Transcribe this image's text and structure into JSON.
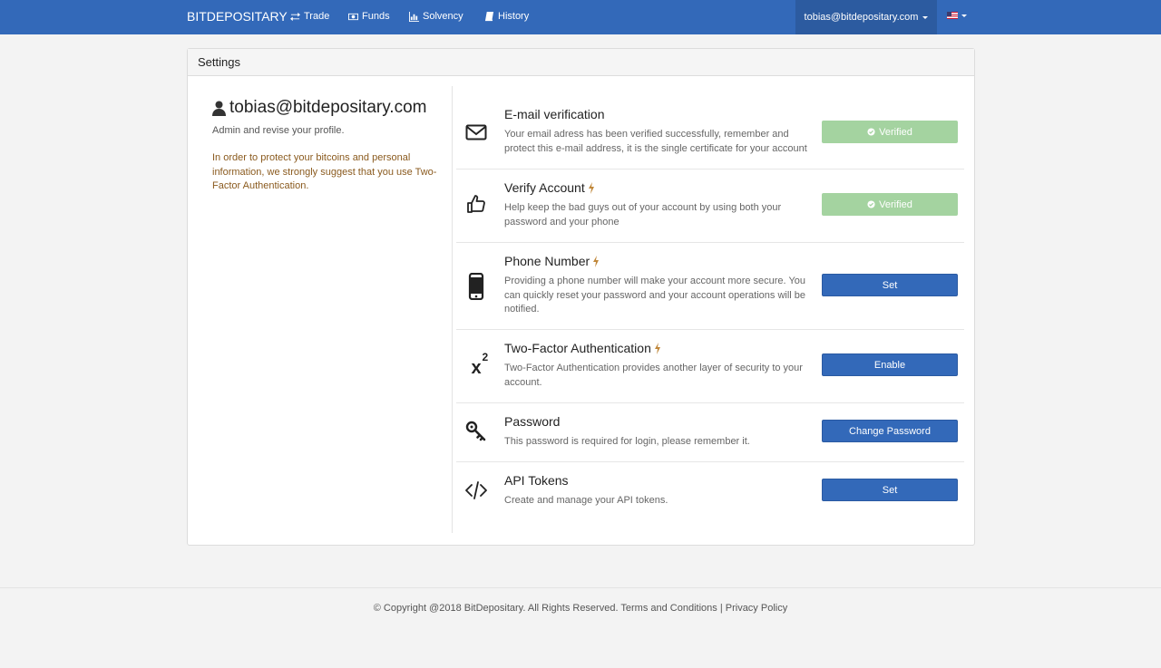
{
  "navbar": {
    "brand": "BITDEPOSITARY",
    "items": [
      {
        "label": "Trade",
        "icon": "transfer-icon"
      },
      {
        "label": "Funds",
        "icon": "money-icon"
      },
      {
        "label": "Solvency",
        "icon": "chart-icon"
      },
      {
        "label": "History",
        "icon": "book-icon"
      }
    ],
    "account_email": "tobias@bitdepositary.com",
    "language_flag": "us-flag-icon"
  },
  "panel": {
    "title": "Settings"
  },
  "profile": {
    "email": "tobias@bitdepositary.com",
    "subtitle": "Admin and revise your profile.",
    "warning": "In order to protect your bitcoins and personal information, we strongly suggest that you use Two-Factor Authentication."
  },
  "settings": [
    {
      "icon": "envelope-icon",
      "title": "E-mail verification",
      "description": "Your email adress has been verified successfully, remember and protect this e-mail address, it is the single certificate for your account",
      "button": "Verified",
      "status": "verified"
    },
    {
      "icon": "thumbs-up-icon",
      "title": "Verify Account",
      "description": "Help keep the bad guys out of your account by using both your password and your phone",
      "button": "Verified",
      "status": "verified"
    },
    {
      "icon": "mobile-phone-icon",
      "title": "Phone Number",
      "description": "Providing a phone number will make your account more secure. You can quickly reset your password and your account operations will be notified.",
      "button": "Set",
      "status": "action"
    },
    {
      "icon": "superscript-icon",
      "title": "Two-Factor Authentication",
      "description": "Two-Factor Authentication provides another layer of security to your account.",
      "button": "Enable",
      "status": "action"
    },
    {
      "icon": "key-icon",
      "title": "Password",
      "description": "This password is required for login, please remember it.",
      "button": "Change Password",
      "status": "action"
    },
    {
      "icon": "code-icon",
      "title": "API Tokens",
      "description": "Create and manage your API tokens.",
      "button": "Set",
      "status": "action"
    }
  ],
  "footer": {
    "copyright": "© Copyright @2018 BitDepositary. All Rights Reserved.",
    "terms": "Terms and Conditions",
    "separator": "|",
    "privacy": "Privacy Policy"
  },
  "colors": {
    "brand_blue": "#3369b9",
    "verified_green": "#a4d3a0",
    "warning_text": "#8a5a1e",
    "bolt": "#c0873a"
  }
}
